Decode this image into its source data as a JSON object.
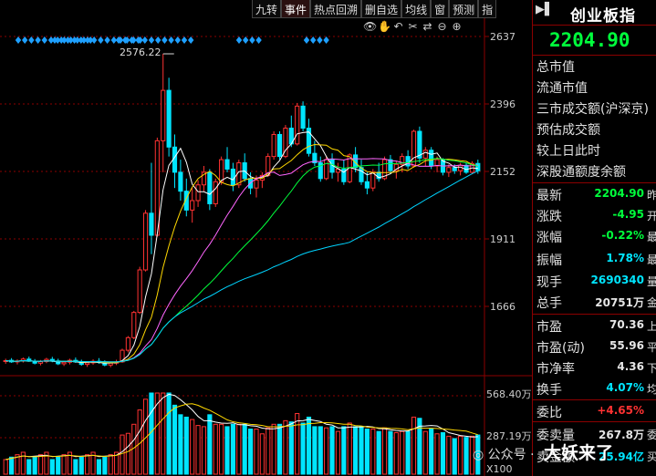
{
  "toolbar": {
    "items": [
      "九转",
      "事件",
      "热点回溯",
      "删自选",
      "均线",
      "窗",
      "预测",
      "指"
    ]
  },
  "axis": {
    "price_ticks": [
      "2637",
      "2396",
      "2152",
      "1911",
      "1666"
    ],
    "volume_ticks": [
      "568.40万",
      "287.19万",
      "X100"
    ]
  },
  "chart_annotations": {
    "high_label": "2576.22"
  },
  "chart_data": {
    "type": "candlestick",
    "ylim": [
      1560,
      2660
    ],
    "prices": [
      [
        1600,
        1608,
        1592,
        1602
      ],
      [
        1603,
        1610,
        1595,
        1598
      ],
      [
        1598,
        1606,
        1590,
        1601
      ],
      [
        1601,
        1612,
        1596,
        1607
      ],
      [
        1607,
        1615,
        1598,
        1600
      ],
      [
        1600,
        1607,
        1590,
        1594
      ],
      [
        1594,
        1604,
        1587,
        1599
      ],
      [
        1599,
        1611,
        1594,
        1606
      ],
      [
        1606,
        1614,
        1597,
        1601
      ],
      [
        1601,
        1608,
        1588,
        1592
      ],
      [
        1592,
        1602,
        1585,
        1597
      ],
      [
        1597,
        1608,
        1590,
        1603
      ],
      [
        1603,
        1612,
        1595,
        1598
      ],
      [
        1598,
        1605,
        1586,
        1590
      ],
      [
        1590,
        1600,
        1582,
        1595
      ],
      [
        1595,
        1606,
        1589,
        1600
      ],
      [
        1600,
        1610,
        1592,
        1596
      ],
      [
        1596,
        1603,
        1584,
        1588
      ],
      [
        1588,
        1599,
        1581,
        1594
      ],
      [
        1594,
        1605,
        1588,
        1598
      ],
      [
        1598,
        1640,
        1595,
        1635
      ],
      [
        1635,
        1680,
        1628,
        1675
      ],
      [
        1675,
        1760,
        1670,
        1755
      ],
      [
        1755,
        1900,
        1750,
        1890
      ],
      [
        1890,
        2080,
        1885,
        2070
      ],
      [
        2070,
        2230,
        1940,
        2000
      ],
      [
        2000,
        2310,
        1995,
        2300
      ],
      [
        2300,
        2576,
        2200,
        2460
      ],
      [
        2460,
        2500,
        2250,
        2280
      ],
      [
        2280,
        2320,
        2150,
        2200
      ],
      [
        2200,
        2240,
        2110,
        2140
      ],
      [
        2140,
        2180,
        2060,
        2080
      ],
      [
        2080,
        2150,
        2040,
        2110
      ],
      [
        2110,
        2175,
        2090,
        2160
      ],
      [
        2160,
        2220,
        2140,
        2200
      ],
      [
        2200,
        2210,
        2080,
        2100
      ],
      [
        2100,
        2180,
        2090,
        2170
      ],
      [
        2170,
        2250,
        2160,
        2240
      ],
      [
        2240,
        2280,
        2200,
        2210
      ],
      [
        2210,
        2230,
        2140,
        2160
      ],
      [
        2160,
        2240,
        2150,
        2230
      ],
      [
        2230,
        2260,
        2170,
        2180
      ],
      [
        2180,
        2200,
        2130,
        2150
      ],
      [
        2150,
        2190,
        2120,
        2175
      ],
      [
        2175,
        2200,
        2150,
        2190
      ],
      [
        2190,
        2260,
        2185,
        2250
      ],
      [
        2250,
        2330,
        2240,
        2320
      ],
      [
        2320,
        2330,
        2240,
        2250
      ],
      [
        2250,
        2350,
        2245,
        2340
      ],
      [
        2340,
        2380,
        2280,
        2290
      ],
      [
        2290,
        2420,
        2285,
        2410
      ],
      [
        2410,
        2425,
        2330,
        2340
      ],
      [
        2340,
        2370,
        2250,
        2260
      ],
      [
        2260,
        2300,
        2220,
        2230
      ],
      [
        2230,
        2250,
        2170,
        2180
      ],
      [
        2180,
        2250,
        2175,
        2240
      ],
      [
        2240,
        2260,
        2180,
        2200
      ],
      [
        2200,
        2230,
        2170,
        2210
      ],
      [
        2210,
        2240,
        2160,
        2170
      ],
      [
        2170,
        2260,
        2165,
        2255
      ],
      [
        2255,
        2280,
        2200,
        2215
      ],
      [
        2215,
        2240,
        2160,
        2170
      ],
      [
        2170,
        2200,
        2130,
        2150
      ],
      [
        2150,
        2210,
        2140,
        2200
      ],
      [
        2200,
        2230,
        2170,
        2180
      ],
      [
        2180,
        2250,
        2175,
        2240
      ],
      [
        2240,
        2255,
        2195,
        2205
      ],
      [
        2205,
        2235,
        2180,
        2225
      ],
      [
        2225,
        2260,
        2200,
        2250
      ],
      [
        2250,
        2270,
        2210,
        2220
      ],
      [
        2220,
        2335,
        2215,
        2330
      ],
      [
        2330,
        2345,
        2230,
        2245
      ],
      [
        2245,
        2280,
        2220,
        2270
      ],
      [
        2270,
        2280,
        2210,
        2220
      ],
      [
        2220,
        2250,
        2200,
        2240
      ],
      [
        2240,
        2245,
        2190,
        2200
      ],
      [
        2200,
        2225,
        2185,
        2215
      ],
      [
        2215,
        2225,
        2195,
        2205
      ],
      [
        2205,
        2230,
        2190,
        2222
      ],
      [
        2222,
        2230,
        2195,
        2200
      ],
      [
        2200,
        2235,
        2195,
        2228
      ],
      [
        2228,
        2240,
        2195,
        2205
      ]
    ],
    "ma": {
      "ma5": "#ffffff",
      "ma10": "#ffd800",
      "ma20": "#ff66ff",
      "ma30": "#00ff3c",
      "ma60": "#00d4ff"
    },
    "volume_colors": {
      "up": "#ff3232",
      "down": "#00e5ff"
    }
  },
  "panel": {
    "title": "创业板指",
    "price": "2204.90",
    "fundamentals": [
      "总市值",
      "流通市值",
      "三市成交额(沪深京)",
      "预估成交额",
      "较上日此时",
      "深股通额度余额"
    ],
    "quote_rows": [
      {
        "label": "最新",
        "value": "2204.90",
        "unit": "昨",
        "color": "green"
      },
      {
        "label": "涨跌",
        "value": "-4.95",
        "unit": "开",
        "color": "green"
      },
      {
        "label": "涨幅",
        "value": "-0.22%",
        "unit": "最",
        "color": "green"
      },
      {
        "label": "振幅",
        "value": "1.78%",
        "unit": "最",
        "color": "cyan"
      },
      {
        "label": "现手",
        "value": "2690340",
        "unit": "量",
        "color": "cyan"
      },
      {
        "label": "总手",
        "value": "20751万",
        "unit": "金",
        "color": "white"
      },
      {
        "label": "市盈",
        "value": "70.36",
        "unit": "上",
        "color": "white"
      },
      {
        "label": "市盈(动)",
        "value": "55.96",
        "unit": "平",
        "color": "white"
      },
      {
        "label": "市净率",
        "value": "4.36",
        "unit": "下",
        "color": "white"
      },
      {
        "label": "换手",
        "value": "4.07%",
        "unit": "均",
        "color": "cyan"
      },
      {
        "label": "委比",
        "value": "+4.65%",
        "unit": "",
        "color": "red"
      },
      {
        "label": "委卖量",
        "value": "267.8万",
        "unit": "委",
        "color": "white"
      },
      {
        "label": "卖金额",
        "value": "25.94亿",
        "unit": "买",
        "color": "cyan"
      }
    ]
  },
  "watermark": {
    "prefix": "公众号 ·",
    "name": "大妖来了"
  }
}
